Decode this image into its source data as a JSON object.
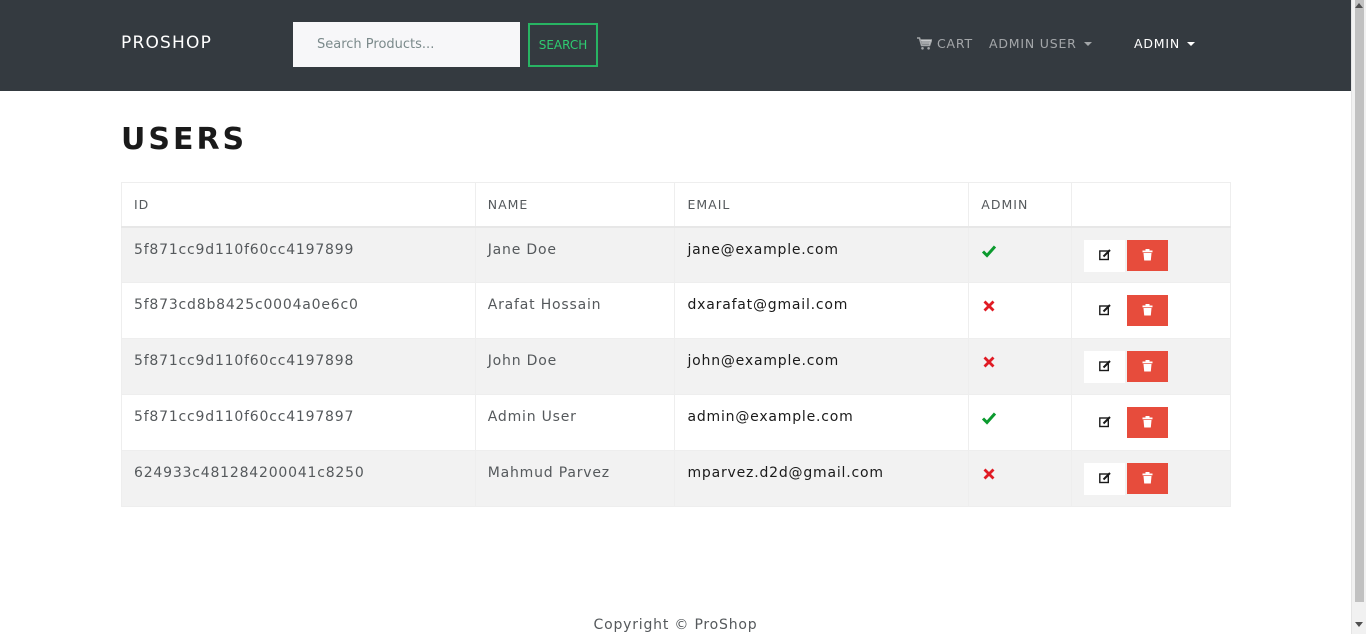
{
  "navbar": {
    "brand": "PROSHOP",
    "search_placeholder": "Search Products...",
    "search_button": "SEARCH",
    "cart_label": "CART",
    "user_label": "ADMIN USER",
    "admin_label": "ADMIN"
  },
  "page": {
    "title": "USERS"
  },
  "table": {
    "headers": [
      "ID",
      "NAME",
      "EMAIL",
      "ADMIN",
      ""
    ],
    "rows": [
      {
        "id": "5f871cc9d110f60cc4197899",
        "name": "Jane Doe",
        "email": "jane@example.com",
        "is_admin": true
      },
      {
        "id": "5f873cd8b8425c0004a0e6c0",
        "name": "Arafat Hossain",
        "email": "dxarafat@gmail.com",
        "is_admin": false
      },
      {
        "id": "5f871cc9d110f60cc4197898",
        "name": "John Doe",
        "email": "john@example.com",
        "is_admin": false
      },
      {
        "id": "5f871cc9d110f60cc4197897",
        "name": "Admin User",
        "email": "admin@example.com",
        "is_admin": true
      },
      {
        "id": "624933c481284200041c8250",
        "name": "Mahmud Parvez",
        "email": "mparvez.d2d@gmail.com",
        "is_admin": false
      }
    ]
  },
  "icons": {
    "cart": "cart-icon",
    "admin_true": "check-icon",
    "admin_false": "times-icon",
    "edit": "edit-icon",
    "delete": "trash-icon"
  },
  "colors": {
    "navbar_bg": "#343a40",
    "search_accent": "#2ecc71",
    "check_green": "#0b9a2e",
    "times_red": "#e01b24",
    "delete_red": "#e74c3c"
  },
  "footer": {
    "copyright": "Copyright © ProShop"
  }
}
